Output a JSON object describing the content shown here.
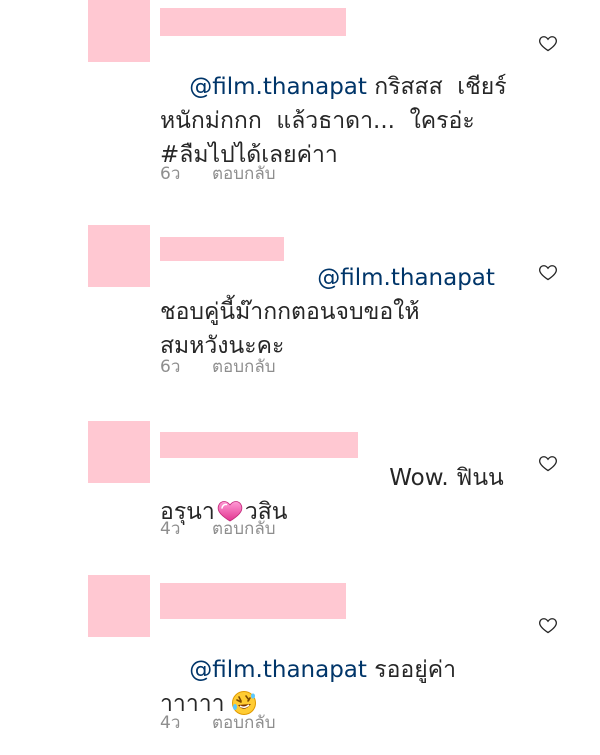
{
  "comments": [
    {
      "mention": "@film.thanapat",
      "text_line1": " กริสสส  เชียร์",
      "text_line2": "หนักม่กกก  แล้วธาดา...  ใครอ่ะ",
      "text_line3": "#ลืมไปได้เลยค่าา",
      "age": "6ว",
      "reply": "ตอบกลับ"
    },
    {
      "mention": "@film.thanapat",
      "text_line1": "ชอบคู่นี้ม๊ากกตอนจบขอให้",
      "text_line2": "สมหวังนะคะ",
      "age": "6ว",
      "reply": "ตอบกลับ"
    },
    {
      "text_tail": "Wow. ฟินน",
      "text_line2a": "อรุนา",
      "text_line2b": "วสิน",
      "emoji": "pink-heart-emoji",
      "age": "4ว",
      "reply": "ตอบกลับ"
    },
    {
      "mention": "@film.thanapat",
      "text_line1": " รออยู่ค่า",
      "text_line2": "าาาาา",
      "emoji": "rofl-emoji",
      "age": "4ว",
      "reply": "ตอบกลับ"
    }
  ],
  "colors": {
    "text": "#262626",
    "mention": "#003569",
    "meta": "#8e8e8e",
    "redaction": "#ffc8d2"
  },
  "icons": {
    "like": "heart-outline-icon"
  }
}
